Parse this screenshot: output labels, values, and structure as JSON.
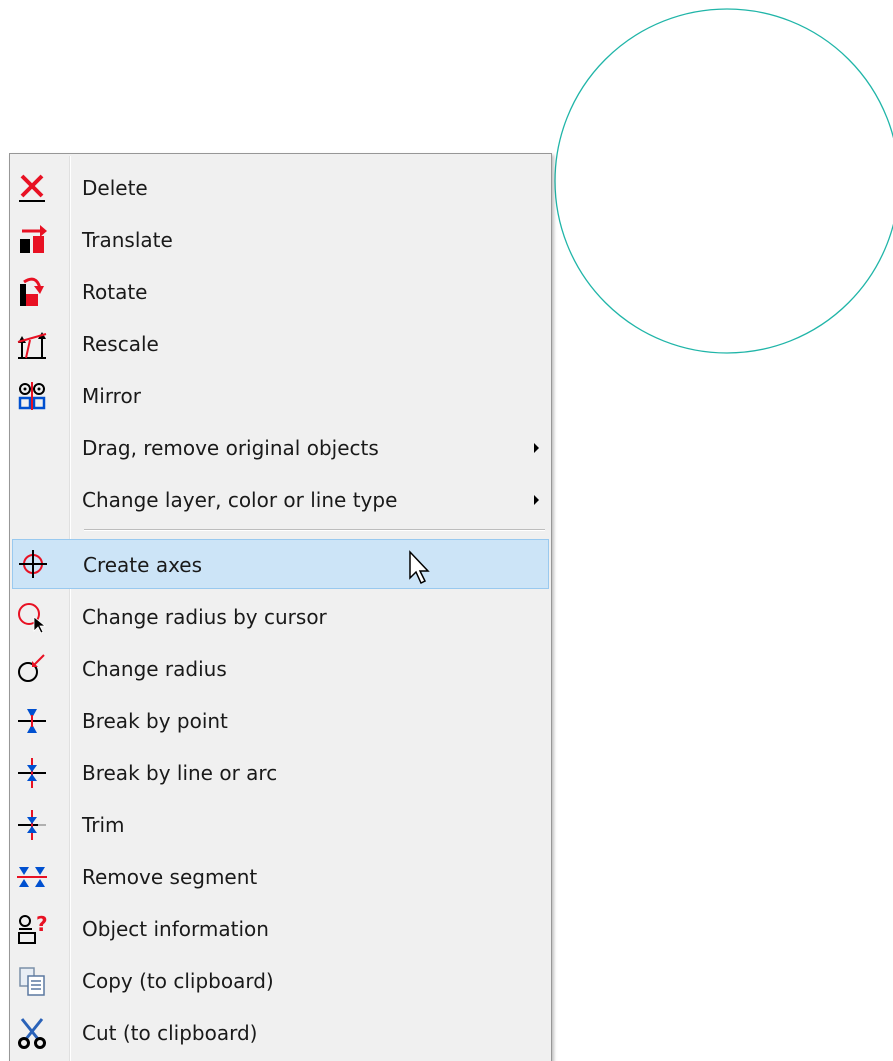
{
  "canvas": {
    "circle_color": "#20b5a8"
  },
  "context_menu": {
    "items": [
      {
        "label": "Delete",
        "icon": "delete-x-icon"
      },
      {
        "label": "Translate",
        "icon": "translate-icon"
      },
      {
        "label": "Rotate",
        "icon": "rotate-icon"
      },
      {
        "label": "Rescale",
        "icon": "rescale-icon"
      },
      {
        "label": "Mirror",
        "icon": "mirror-icon"
      },
      {
        "label": "Drag, remove original objects",
        "has_submenu": true
      },
      {
        "label": "Change layer, color or line type",
        "has_submenu": true
      },
      {
        "label": "Create axes",
        "icon": "crosshair-axes-icon",
        "highlighted": true
      },
      {
        "label": "Change radius by cursor",
        "icon": "radius-cursor-icon"
      },
      {
        "label": "Change radius",
        "icon": "change-radius-icon"
      },
      {
        "label": "Break by point",
        "icon": "break-point-icon"
      },
      {
        "label": "Break by line or arc",
        "icon": "break-line-icon"
      },
      {
        "label": "Trim",
        "icon": "trim-icon"
      },
      {
        "label": "Remove segment",
        "icon": "remove-segment-icon"
      },
      {
        "label": "Object information",
        "icon": "object-info-icon"
      },
      {
        "label": "Copy (to clipboard)",
        "icon": "copy-icon"
      },
      {
        "label": "Cut (to clipboard)",
        "icon": "cut-scissors-icon"
      }
    ],
    "highlight_color": "#cce4f7",
    "accent_red": "#e81123"
  }
}
